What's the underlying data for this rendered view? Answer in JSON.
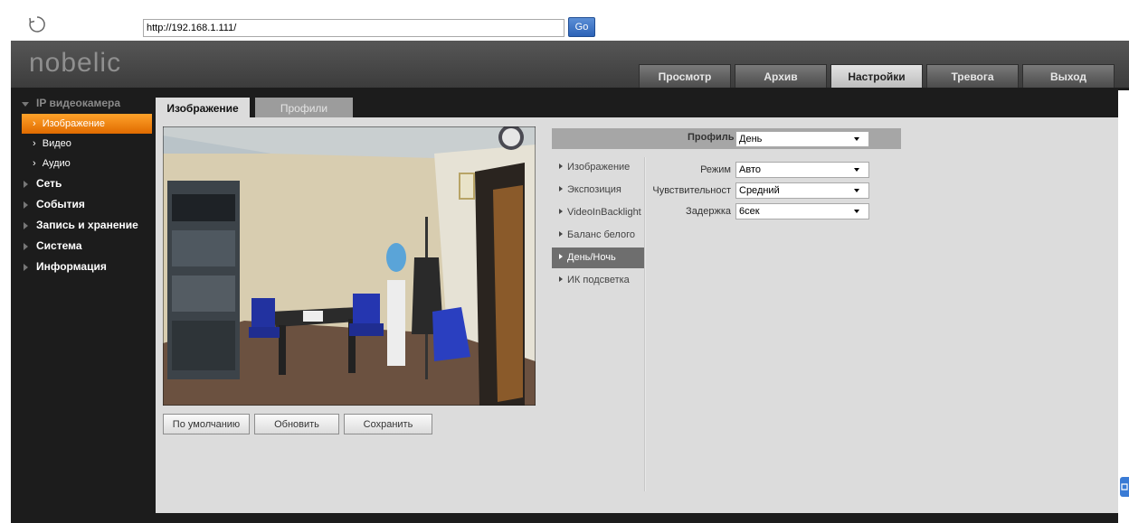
{
  "browser": {
    "url": "http://192.168.1.111/",
    "go_label": "Go"
  },
  "header": {
    "logo": "nobelic",
    "tabs": [
      {
        "label": "Просмотр",
        "active": false
      },
      {
        "label": "Архив",
        "active": false
      },
      {
        "label": "Настройки",
        "active": true
      },
      {
        "label": "Тревога",
        "active": false
      },
      {
        "label": "Выход",
        "active": false
      }
    ]
  },
  "sidebar": {
    "group": "IP видеокамера",
    "sub_items": [
      {
        "label": "Изображение",
        "active": true
      },
      {
        "label": "Видео",
        "active": false
      },
      {
        "label": "Аудио",
        "active": false
      }
    ],
    "items": [
      "Сеть",
      "События",
      "Запись и хранение",
      "Система",
      "Информация"
    ]
  },
  "content": {
    "tabs": [
      {
        "label": "Изображение",
        "active": true
      },
      {
        "label": "Профили",
        "active": false
      }
    ],
    "buttons": {
      "default": "По умолчанию",
      "refresh": "Обновить",
      "save": "Сохранить"
    },
    "profile": {
      "label": "Профиль",
      "value": "День"
    },
    "submenu": [
      {
        "label": "Изображение",
        "active": false
      },
      {
        "label": "Экспозиция",
        "active": false
      },
      {
        "label": "VideoInBacklight",
        "active": false
      },
      {
        "label": "Баланс белого",
        "active": false
      },
      {
        "label": "День/Ночь",
        "active": true
      },
      {
        "label": "ИК подсветка",
        "active": false
      }
    ],
    "fields": [
      {
        "label": "Режим",
        "value": "Авто"
      },
      {
        "label": "Чувствительност",
        "value": "Средний"
      },
      {
        "label": "Задержка",
        "value": "6сек"
      }
    ]
  },
  "colors": {
    "accent": "#f08a10",
    "sidebar_bg": "#1c1c1c",
    "content_bg": "#dcdcdc",
    "header_bg": "#4a4a4a"
  }
}
